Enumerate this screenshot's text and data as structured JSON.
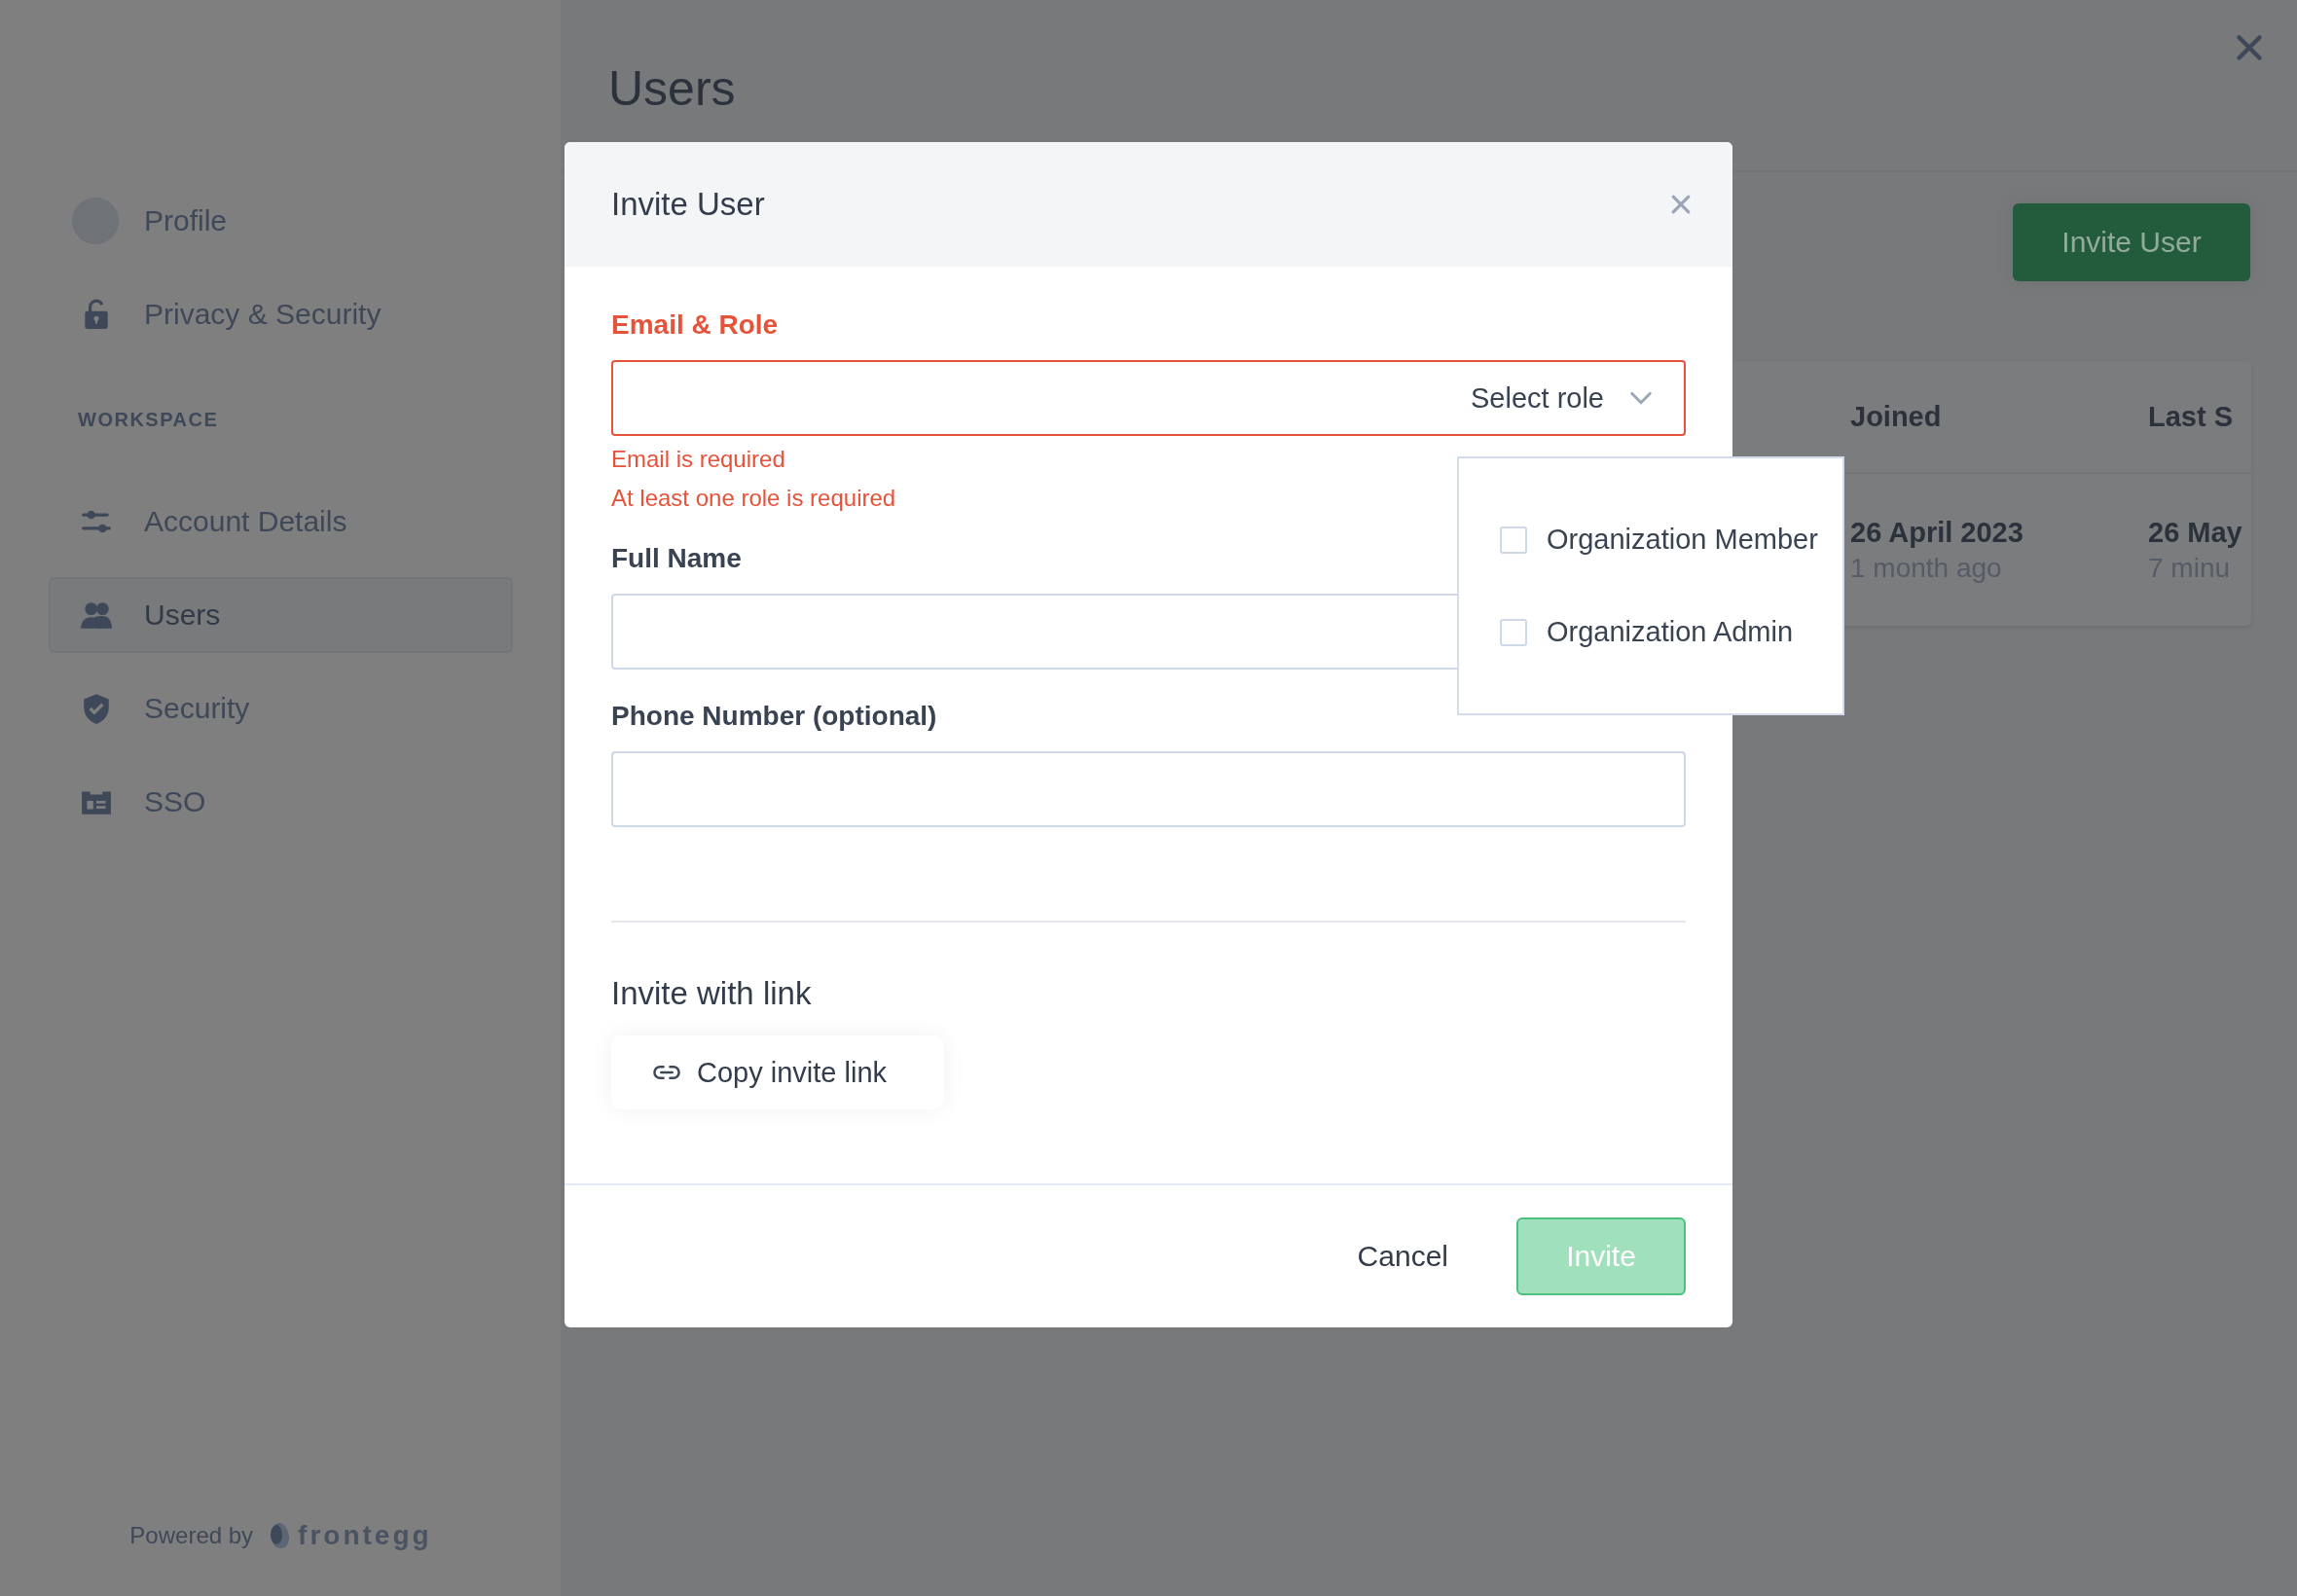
{
  "sidebar": {
    "top_items": [
      {
        "label": "Profile",
        "kind": "avatar",
        "selected": false
      },
      {
        "label": "Privacy & Security",
        "kind": "lock",
        "selected": false
      }
    ],
    "section": {
      "title": "WORKSPACE",
      "items": [
        {
          "label": "Account Details",
          "kind": "sliders",
          "selected": false
        },
        {
          "label": "Users",
          "kind": "users",
          "selected": true
        },
        {
          "label": "Security",
          "kind": "shield",
          "selected": false
        },
        {
          "label": "SSO",
          "kind": "card",
          "selected": false
        }
      ]
    },
    "footer": {
      "text": "Powered by",
      "logo": "frontegg"
    }
  },
  "main": {
    "title": "Users",
    "invite_button": "Invite User",
    "table": {
      "columns": [
        "Joined",
        "Last S"
      ],
      "rows": [
        {
          "cells": [
            {
              "primary": "26 April 2023",
              "secondary": "1 month ago"
            },
            {
              "primary": "26 May",
              "secondary": "7 minu"
            }
          ]
        }
      ]
    }
  },
  "modal": {
    "title": "Invite User",
    "fields": [
      {
        "kind": "email_role",
        "label": "Email & Role",
        "error": true,
        "select_placeholder": "Select role",
        "errors": [
          "Email is required",
          "At least one role is required"
        ]
      },
      {
        "kind": "text",
        "label": "Full Name",
        "error": false
      },
      {
        "kind": "text",
        "label": "Phone Number (optional)",
        "error": false
      }
    ],
    "link_section": {
      "title": "Invite with link",
      "button": "Copy invite link"
    },
    "cancel": "Cancel",
    "submit": {
      "label": "Invite",
      "disabled": true
    },
    "role_dropdown": {
      "options": [
        {
          "label": "Organization Member",
          "checked": false
        },
        {
          "label": "Organization Admin",
          "checked": false
        }
      ]
    }
  }
}
